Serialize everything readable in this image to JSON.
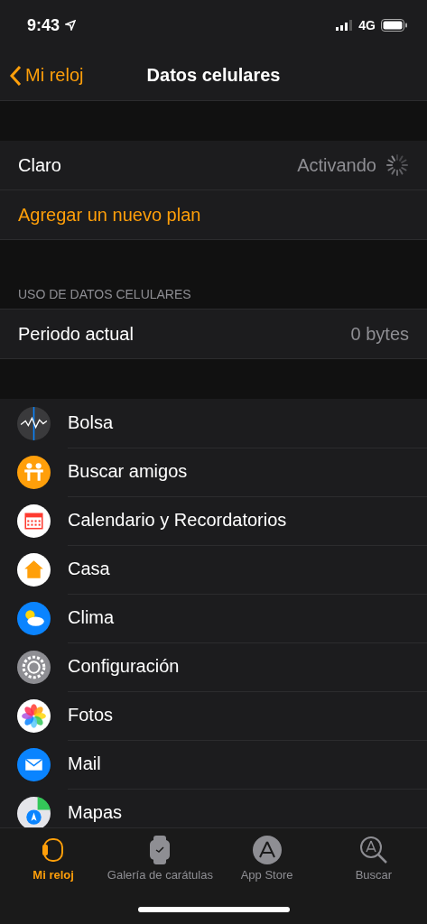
{
  "status_bar": {
    "time": "9:43",
    "network": "4G"
  },
  "nav": {
    "back": "Mi reloj",
    "title": "Datos celulares"
  },
  "carrier": {
    "name": "Claro",
    "status": "Activando",
    "loading": true
  },
  "add_plan": "Agregar un nuevo plan",
  "usage": {
    "header": "USO DE DATOS CELULARES",
    "label": "Periodo actual",
    "value": "0 bytes"
  },
  "apps": [
    {
      "name": "Bolsa"
    },
    {
      "name": "Buscar amigos"
    },
    {
      "name": "Calendario y Recordatorios"
    },
    {
      "name": "Casa"
    },
    {
      "name": "Clima"
    },
    {
      "name": "Configuración"
    },
    {
      "name": "Fotos"
    },
    {
      "name": "Mail"
    },
    {
      "name": "Mapas"
    }
  ],
  "tabs": [
    {
      "label": "Mi reloj",
      "selected": true
    },
    {
      "label": "Galería de carátulas",
      "selected": false
    },
    {
      "label": "App Store",
      "selected": false
    },
    {
      "label": "Buscar",
      "selected": false
    }
  ]
}
